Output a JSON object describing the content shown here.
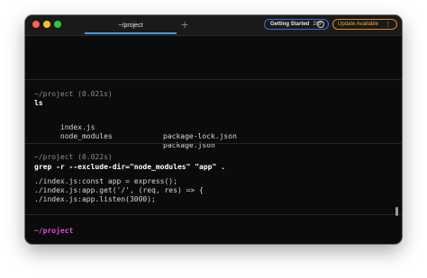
{
  "titlebar": {
    "tab_title": "~/project",
    "new_tab_label": "+",
    "getting_started": {
      "label": "Getting Started",
      "progress": "2/5",
      "help_glyph": "?"
    },
    "update": {
      "label": "Update Available",
      "menu_glyph": "⋮"
    }
  },
  "blocks": [
    {
      "prompt": "~/project (0.021s)",
      "command": "ls",
      "output": [
        {
          "a": "index.js",
          "b": "package-lock.json"
        },
        {
          "a": "node_modules",
          "b": "package.json"
        }
      ]
    },
    {
      "prompt": "~/project (0.022s)",
      "command": "grep -r --exclude-dir=\"node_modules\" \"app\" .",
      "output": [
        "./index.js:const app = express();",
        "./index.js:app.get('/', (req, res) => {",
        "./index.js:app.listen(3000);"
      ]
    }
  ],
  "current_prompt": "~/project",
  "colors": {
    "background": "#0b0b0b",
    "accent_tab": "#4a9be0",
    "getting_started_border": "#3d6fd1",
    "update_accent": "#f0a23a",
    "prompt_current": "#e04fd8"
  }
}
